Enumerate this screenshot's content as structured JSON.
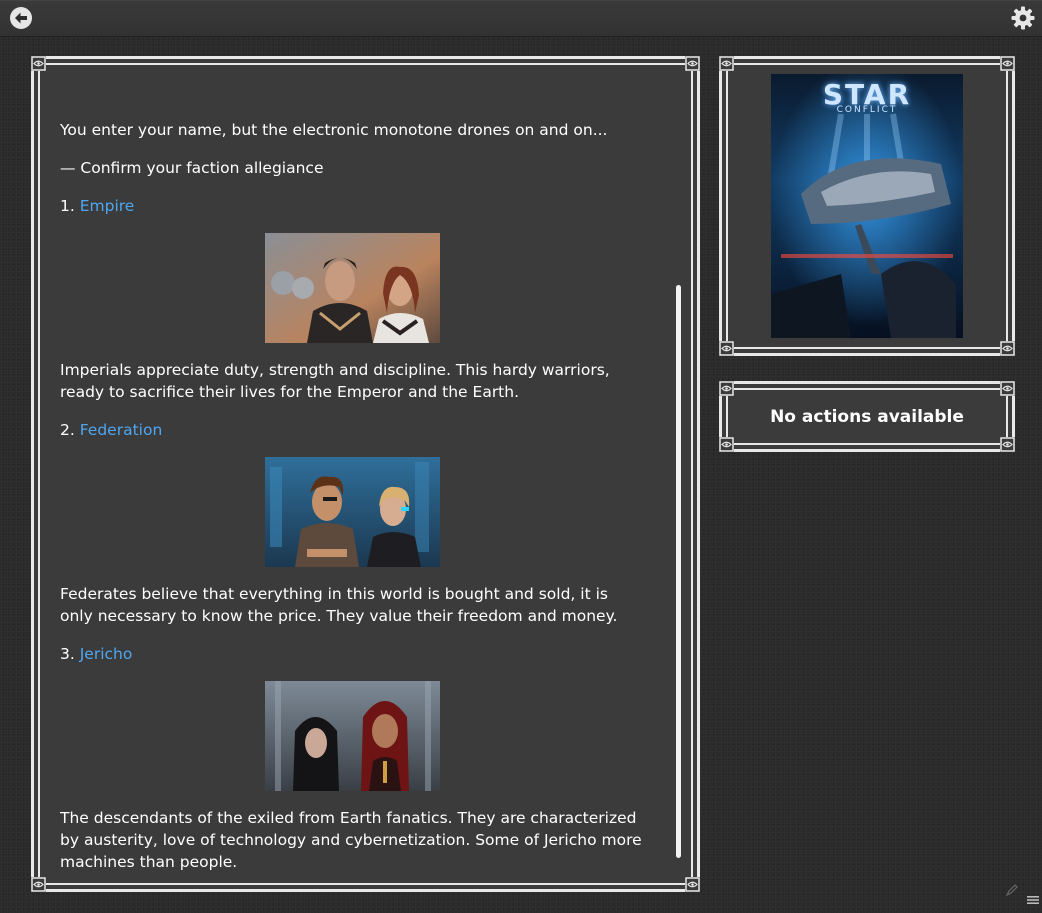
{
  "toolbar": {
    "back_icon": "back-arrow-icon",
    "settings_icon": "gear-icon"
  },
  "story": {
    "intro": "You enter your name, but the electronic monotone drones on and on...",
    "prompt": "— Confirm your faction allegiance",
    "choices": [
      {
        "number": "1.",
        "label": "Empire",
        "description": "Imperials appreciate duty, strength and discipline. This hardy warriors, ready to sacrifice their lives for the Emperor and the Earth."
      },
      {
        "number": "2.",
        "label": "Federation",
        "description": "Federates believe that everything in this world is bought and sold, it is only necessary to know the price. They value their freedom and money."
      },
      {
        "number": "3.",
        "label": "Jericho",
        "description": "The descendants of the exiled from Earth fanatics. They are characterized by austerity, love of technology and cybernetization. Some of Jericho more machines than people."
      }
    ]
  },
  "cover": {
    "title": "STAR",
    "subtitle": "CONFLICT"
  },
  "actions": {
    "empty_label": "No actions available"
  },
  "colors": {
    "link": "#4ea6f0",
    "frame": "#e8e8e8",
    "panel": "#3b3b3b"
  }
}
